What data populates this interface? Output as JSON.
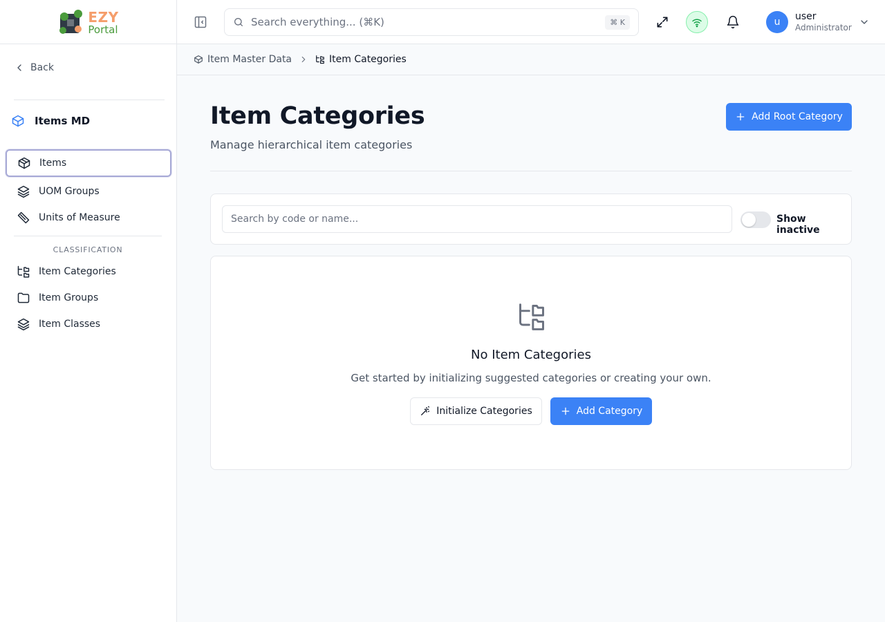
{
  "logo": {
    "brand": "EZY",
    "sub": "Portal"
  },
  "sidebar": {
    "back_label": "Back",
    "module_title": "Items MD",
    "items": [
      {
        "label": "Items",
        "icon": "package-icon"
      },
      {
        "label": "UOM Groups",
        "icon": "layers-icon"
      },
      {
        "label": "Units of Measure",
        "icon": "ruler-icon"
      }
    ],
    "section_label": "CLASSIFICATION",
    "classification_items": [
      {
        "label": "Item Categories",
        "icon": "folder-tree-icon"
      },
      {
        "label": "Item Groups",
        "icon": "folder-icon"
      },
      {
        "label": "Item Classes",
        "icon": "layers-icon"
      }
    ]
  },
  "header": {
    "search_placeholder": "Search everything... (⌘K)",
    "search_shortcut": "⌘ K",
    "user": {
      "initial": "u",
      "name": "user",
      "role": "Administrator"
    },
    "status_color": "#22c55e"
  },
  "breadcrumb": {
    "parent": "Item Master Data",
    "current": "Item Categories"
  },
  "main": {
    "title": "Item Categories",
    "subtitle": "Manage hierarchical item categories",
    "add_root_label": "Add Root Category",
    "filter": {
      "search_placeholder": "Search by code or name...",
      "show_inactive_label": "Show inactive",
      "show_inactive": false
    },
    "empty": {
      "title": "No Item Categories",
      "description": "Get started by initializing suggested categories or creating your own.",
      "initialize_label": "Initialize Categories",
      "add_label": "Add Category"
    }
  },
  "colors": {
    "primary": "#3b82f6",
    "active_border": "#a7a9d6"
  }
}
